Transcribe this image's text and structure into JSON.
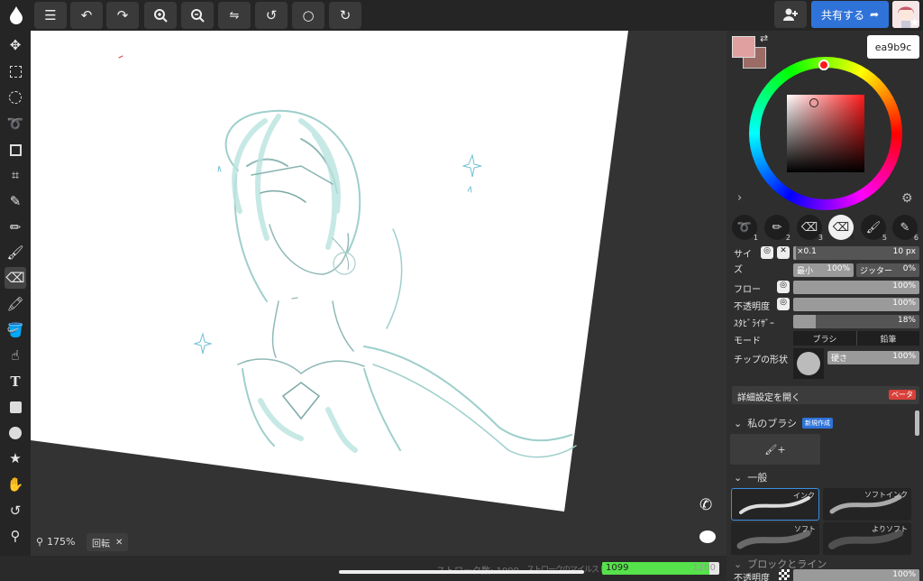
{
  "topbar": {
    "share_label": "共有する",
    "buttons": [
      "menu",
      "undo",
      "redo",
      "zoom-in",
      "zoom-out",
      "flip",
      "rotate",
      "reset-rotate",
      "rotate-alt"
    ]
  },
  "tooltip": {
    "color_hex": "ea9b9c"
  },
  "colors": {
    "primary": "#e0a0a0",
    "secondary": "#9b6b66",
    "accent": "#2f73d9",
    "progress_fill": "#55e24a"
  },
  "canvas": {
    "zoom_label": "175%",
    "rotate_label": "回転"
  },
  "status": {
    "stroke_count_label": "ストローク数: 1099",
    "milestone_label": "ストロークのマイルストーン:",
    "progress_value": "1099",
    "progress_max": "1200",
    "progress_fraction": 0.916
  },
  "brush_settings": {
    "size_label": "サイズ",
    "size_multiplier": "×0.1",
    "size_value": "10 px",
    "size_min_label": "最小",
    "size_min_value": "100%",
    "jitter_label": "ジッター",
    "jitter_value": "0%",
    "flow_label": "フロー",
    "flow_value": "100%",
    "opacity_label": "不透明度",
    "opacity_value": "100%",
    "stabilizer_label": "ｽﾀﾋﾞﾗｲｻﾞｰ",
    "stabilizer_value": "18%",
    "stabilizer_fraction": 0.18,
    "mode_label": "モード",
    "mode_brush": "ブラシ",
    "mode_pencil": "鉛筆",
    "tip_label": "チップの形状",
    "hardness_label": "硬さ",
    "hardness_value": "100%",
    "advanced_label": "詳細設定を開く",
    "beta_badge": "ベータ"
  },
  "pens": [
    "1",
    "2",
    "3",
    "4",
    "5",
    "6"
  ],
  "my_brush": {
    "header": "私のブラシ",
    "new_badge": "新規作成"
  },
  "general": {
    "header": "一般",
    "brushes": [
      "インク",
      "ソフトインク",
      "ソフト",
      "よりソフト"
    ]
  },
  "next_section": {
    "header": "ブロックとライン",
    "opacity_label": "不透明度",
    "opacity_value": "100%"
  }
}
